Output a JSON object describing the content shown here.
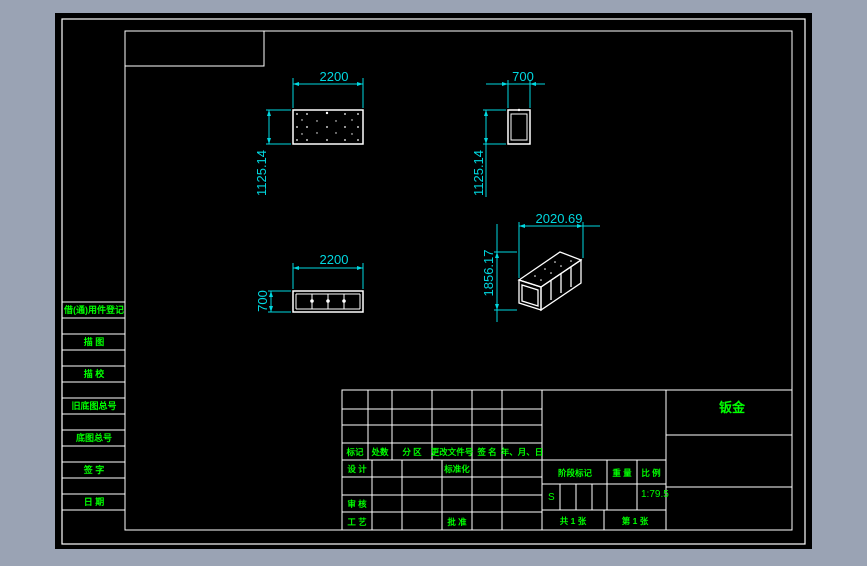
{
  "colors": {
    "background": "#9aa3b4",
    "sheet": "#000000",
    "border": "#ffffff",
    "dimension": "#00d8e0",
    "label": "#00ff00"
  },
  "views": {
    "front": {
      "width_dim": "2200",
      "height_dim": "1125.14"
    },
    "side": {
      "width_dim": "700",
      "height_dim": "1125.14"
    },
    "top": {
      "width_dim": "2200",
      "height_dim": "700"
    },
    "iso": {
      "length_dim": "2020.69",
      "height_dim": "1856.17"
    }
  },
  "left_column": {
    "labels": [
      "借(通)用件登记",
      "描 图",
      "描 校",
      "旧底图总号",
      "底图总号",
      "签 字",
      "日 期"
    ]
  },
  "title_block": {
    "drawing_name": "钣金",
    "revision_headers": [
      "标记",
      "处数",
      "分 区",
      "更改文件号",
      "签 名",
      "年、月、日"
    ],
    "design_label": "设 计",
    "standardization_label": "标准化",
    "review_label": "审 核",
    "process_label": "工 艺",
    "approve_label": "批 准",
    "stage_mark_label": "阶段标记",
    "weight_label": "重 量",
    "scale_label": "比 例",
    "stage_value": "S",
    "scale_value": "1:79.5",
    "sheets_total": "共 1 张",
    "sheet_number": "第 1 张"
  }
}
